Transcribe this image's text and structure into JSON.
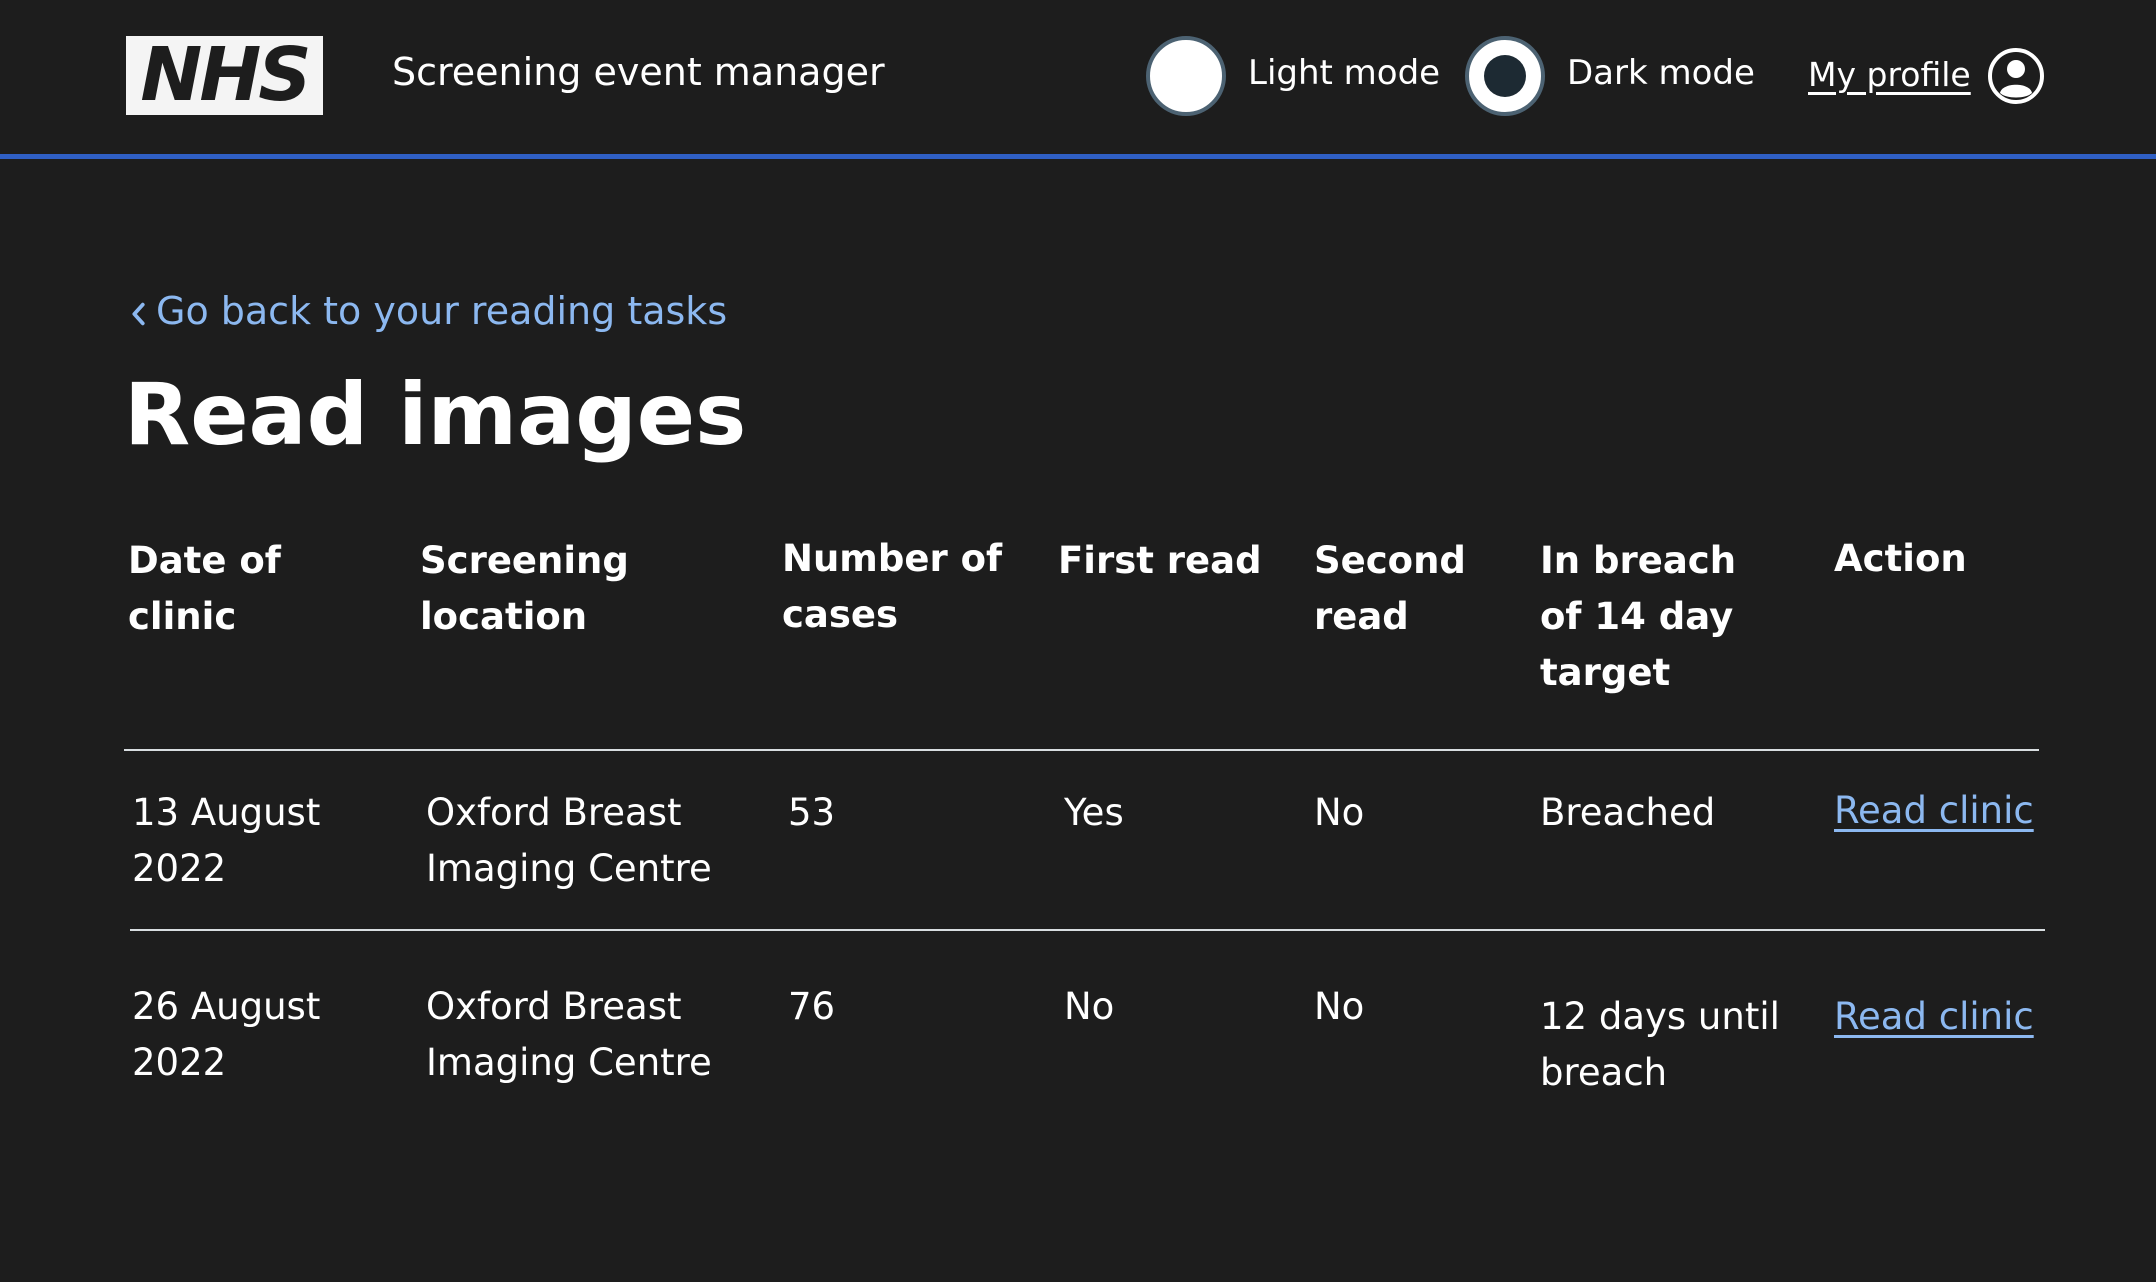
{
  "header": {
    "logo_text": "NHS",
    "service_name": "Screening event manager",
    "light_mode_label": "Light mode",
    "dark_mode_label": "Dark mode",
    "selected_mode": "Dark mode",
    "profile_label": "My profile"
  },
  "back_link": "Go back to your reading tasks",
  "page_title": "Read images",
  "table": {
    "headers": {
      "date": "Date of clinic",
      "location": "Screening location",
      "cases": "Number of cases",
      "first": "First read",
      "second": "Second read",
      "breach": "In breach of 14 day target",
      "action": "Action"
    },
    "rows": [
      {
        "date": "13 August 2022",
        "location": "Oxford Breast Imaging Centre",
        "cases": "53",
        "first": "Yes",
        "second": "No",
        "breach": "Breached",
        "action": "Read clinic"
      },
      {
        "date": "26 August 2022",
        "location": "Oxford Breast Imaging Centre",
        "cases": "76",
        "first": "No",
        "second": "No",
        "breach": "12 days until breach",
        "action": "Read clinic"
      }
    ]
  },
  "colors": {
    "background": "#1d1d1d",
    "header_border": "#2f5fc4",
    "link": "#8cb8f0",
    "text": "#ffffff"
  }
}
